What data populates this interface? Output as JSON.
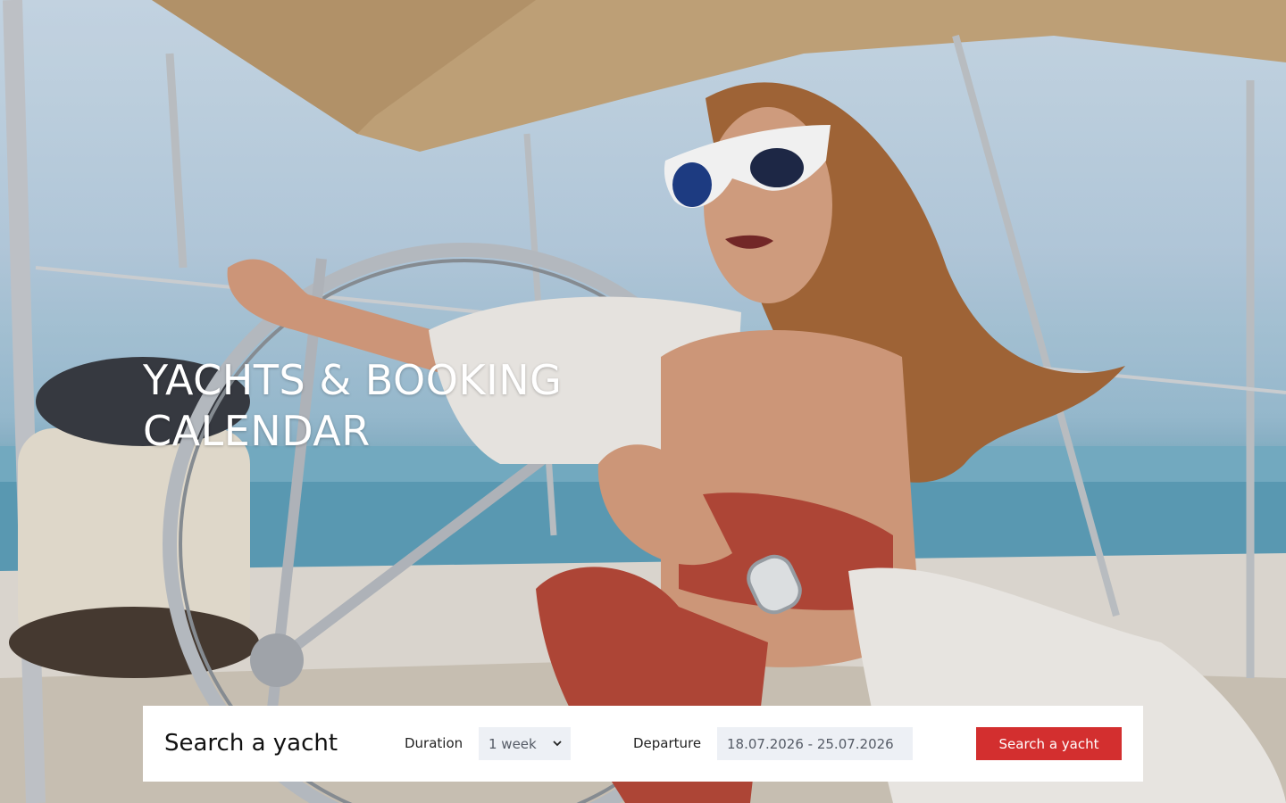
{
  "hero": {
    "title_line1": "YACHTS & BOOKING",
    "title_line2": "CALENDAR"
  },
  "search": {
    "heading": "Search a yacht",
    "duration_label": "Duration",
    "duration_value": "1 week",
    "departure_label": "Departure",
    "departure_value": "18.07.2026 - 25.07.2026",
    "submit_label": "Search a yacht"
  },
  "colors": {
    "accent": "#d32f2f",
    "field_background": "#edf0f5",
    "panel_background": "#ffffff",
    "hero_text": "#ffffff"
  },
  "icons": {
    "duration_dropdown": "chevron-down-icon"
  }
}
